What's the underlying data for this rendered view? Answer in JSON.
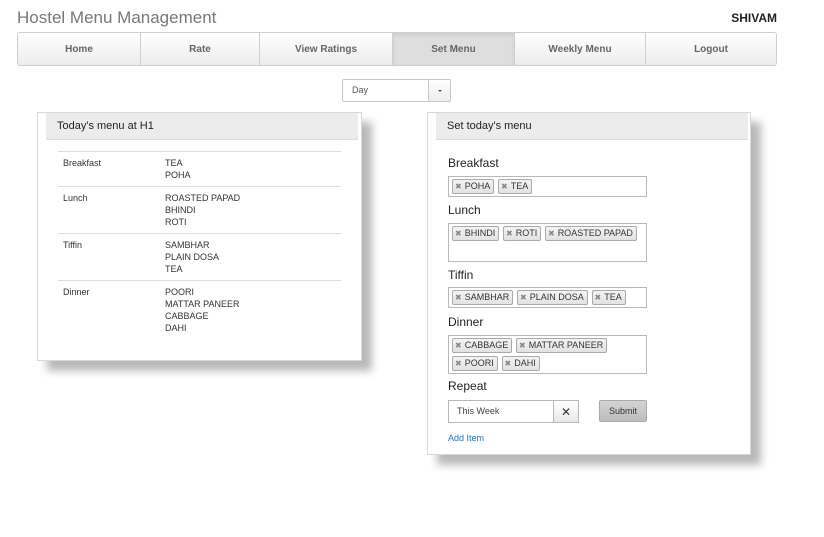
{
  "header": {
    "title": "Hostel Menu Management",
    "user": "SHIVAM"
  },
  "nav": [
    "Home",
    "Rate",
    "View Ratings",
    "Set Menu",
    "Weekly Menu",
    "Logout"
  ],
  "day_select": {
    "value": "Day"
  },
  "today_menu": {
    "title": "Today's menu at H1",
    "rows": [
      {
        "meal": "Breakfast",
        "items": [
          "TEA",
          "POHA"
        ]
      },
      {
        "meal": "Lunch",
        "items": [
          "ROASTED PAPAD",
          "BHINDI",
          "ROTI"
        ]
      },
      {
        "meal": "Tiffin",
        "items": [
          "SAMBHAR",
          "PLAIN DOSA",
          "TEA"
        ]
      },
      {
        "meal": "Dinner",
        "items": [
          "POORI",
          "MATTAR PANEER",
          "CABBAGE",
          "DAHI"
        ]
      }
    ]
  },
  "set_menu": {
    "title": "Set today's menu",
    "sections": [
      {
        "label": "Breakfast",
        "tags": [
          "POHA",
          "TEA"
        ]
      },
      {
        "label": "Lunch",
        "tags": [
          "BHINDI",
          "ROTI",
          "ROASTED PAPAD"
        ]
      },
      {
        "label": "Tiffin",
        "tags": [
          "SAMBHAR",
          "PLAIN DOSA",
          "TEA"
        ]
      },
      {
        "label": "Dinner",
        "tags": [
          "CABBAGE",
          "MATTAR PANEER",
          "POORI",
          "DAHI"
        ]
      }
    ],
    "repeat_label": "Repeat",
    "repeat_value": "This Week",
    "submit_label": "Submit",
    "add_item_label": "Add Item"
  }
}
